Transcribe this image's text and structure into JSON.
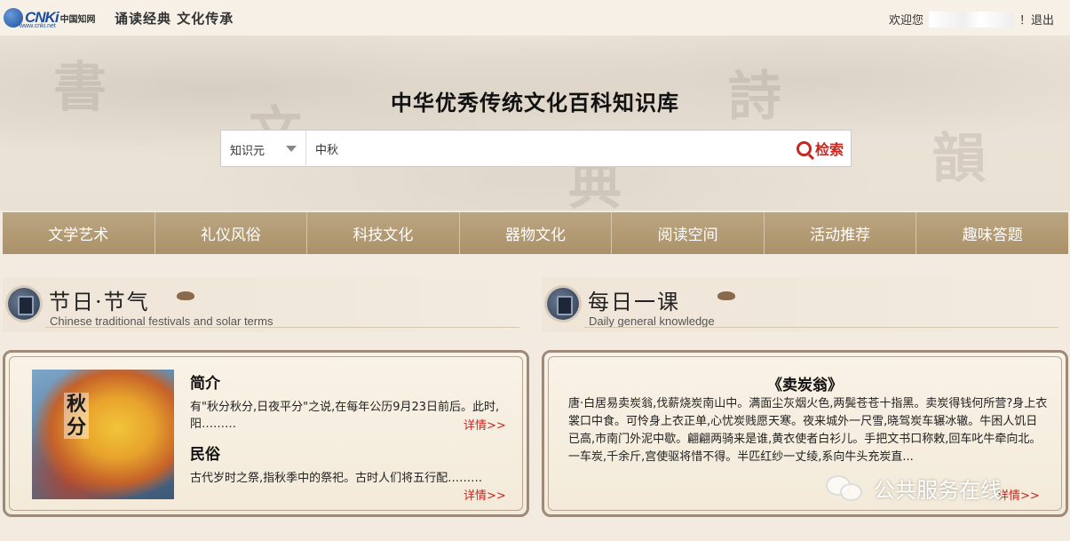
{
  "topbar": {
    "logo_text": "CNKi",
    "logo_cn": "中国知网",
    "logo_sub": "www.cnki.net",
    "slogan": "诵读经典 文化传承",
    "welcome": "欢迎您",
    "exclaim": "！",
    "logout": "退出"
  },
  "hero": {
    "title": "中华优秀传统文化百科知识库",
    "search": {
      "select_value": "知识元",
      "query": "中秋",
      "button_label": "检索"
    }
  },
  "nav": {
    "items": [
      "文学艺术",
      "礼仪风俗",
      "科技文化",
      "器物文化",
      "阅读空间",
      "活动推荐",
      "趣味答题"
    ]
  },
  "festivals": {
    "title": "节日·节气",
    "subtitle": "Chinese traditional festivals and solar terms",
    "image_text": "秋分",
    "intro_title": "简介",
    "intro_text": "有\"秋分秋分,日夜平分\"之说,在每年公历9月23日前后。此时,阳………",
    "custom_title": "民俗",
    "custom_text": "古代岁时之祭,指秋季中的祭祀。古时人们将五行配………",
    "more": "详情>>"
  },
  "daily": {
    "title": "每日一课",
    "subtitle": "Daily general knowledge",
    "poem_title": "《卖炭翁》",
    "poem_text": "唐·白居易卖炭翁,伐薪烧炭南山中。满面尘灰烟火色,两鬓苍苍十指黑。卖炭得钱何所营?身上衣裳口中食。可怜身上衣正单,心忧炭贱愿天寒。夜来城外一尺雪,晓驾炭车辗冰辙。牛困人饥日已高,市南门外泥中歇。翩翩两骑来是谁,黄衣使者白衫儿。手把文书口称敕,回车叱牛牵向北。一车炭,千余斤,宫使驱将惜不得。半匹红纱一丈绫,系向牛头充炭直...",
    "more": "详情>>"
  },
  "watermark": "公共服务在线"
}
